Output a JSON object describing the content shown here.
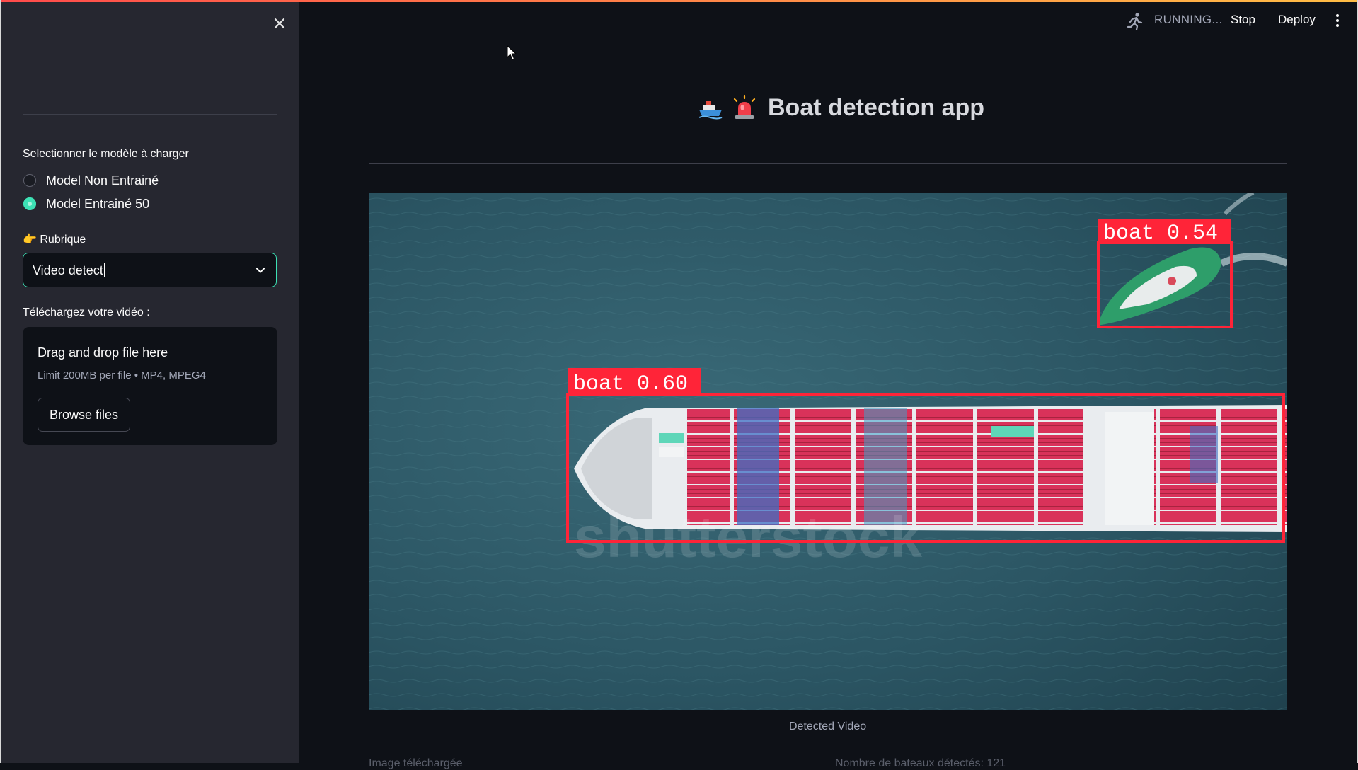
{
  "header": {
    "status": "RUNNING...",
    "stop_label": "Stop",
    "deploy_label": "Deploy"
  },
  "sidebar": {
    "model_label": "Selectionner le modèle à charger",
    "models": [
      {
        "label": "Model Non Entrainé",
        "selected": false
      },
      {
        "label": "Model Entrainé 50",
        "selected": true
      }
    ],
    "rubrique_emoji": "👉",
    "rubrique_label": "Rubrique",
    "rubrique_value": "Video detect",
    "upload_label": "Téléchargez votre vidéo :",
    "upload_title": "Drag and drop file here",
    "upload_limit": "Limit 200MB per file • MP4, MPEG4",
    "browse_label": "Browse files"
  },
  "main": {
    "title": "Boat detection app",
    "video_caption": "Detected Video",
    "detections": [
      {
        "label": "boat 0.54"
      },
      {
        "label": "boat 0.60"
      }
    ],
    "watermark": "shutterstock",
    "footer_left": "Image téléchargée",
    "footer_right": "Nombre de bateaux détectés: 121"
  },
  "colors": {
    "accent": "#3de1b5",
    "background": "#0e1117",
    "sidebar": "#262730",
    "detection_box": "#ff2438"
  }
}
